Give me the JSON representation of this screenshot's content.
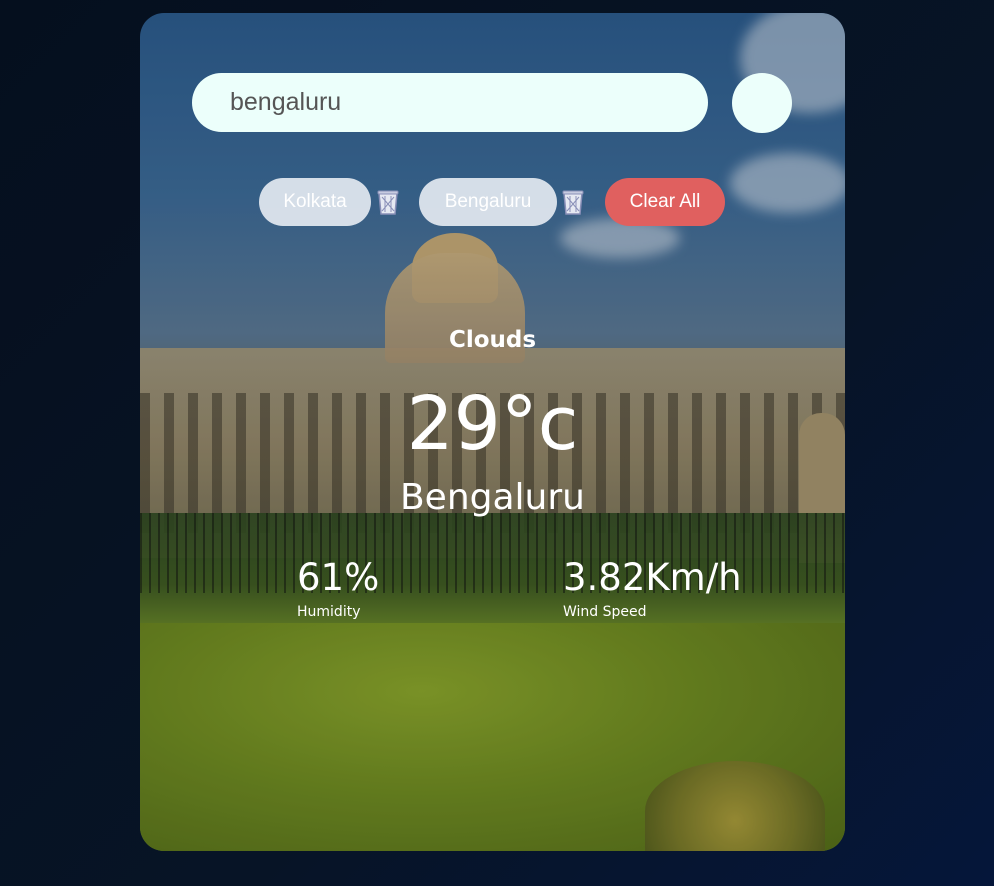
{
  "search": {
    "value": "bengaluru",
    "placeholder": ""
  },
  "history": {
    "items": [
      {
        "label": "Kolkata",
        "delete_icon": "trash-icon"
      },
      {
        "label": "Bengaluru",
        "delete_icon": "trash-icon"
      }
    ],
    "clear_label": "Clear All"
  },
  "weather": {
    "condition": "Clouds",
    "temperature": "29°c",
    "city": "Bengaluru",
    "humidity_value": "61%",
    "humidity_label": "Humidity",
    "wind_value": "3.82Km/h",
    "wind_label": "Wind Speed"
  },
  "colors": {
    "page_background": "#071426",
    "input_background": "#ecfffb",
    "chip_background": "#ecf0f6",
    "clear_button": "#e0605f",
    "text": "#ffffff"
  }
}
